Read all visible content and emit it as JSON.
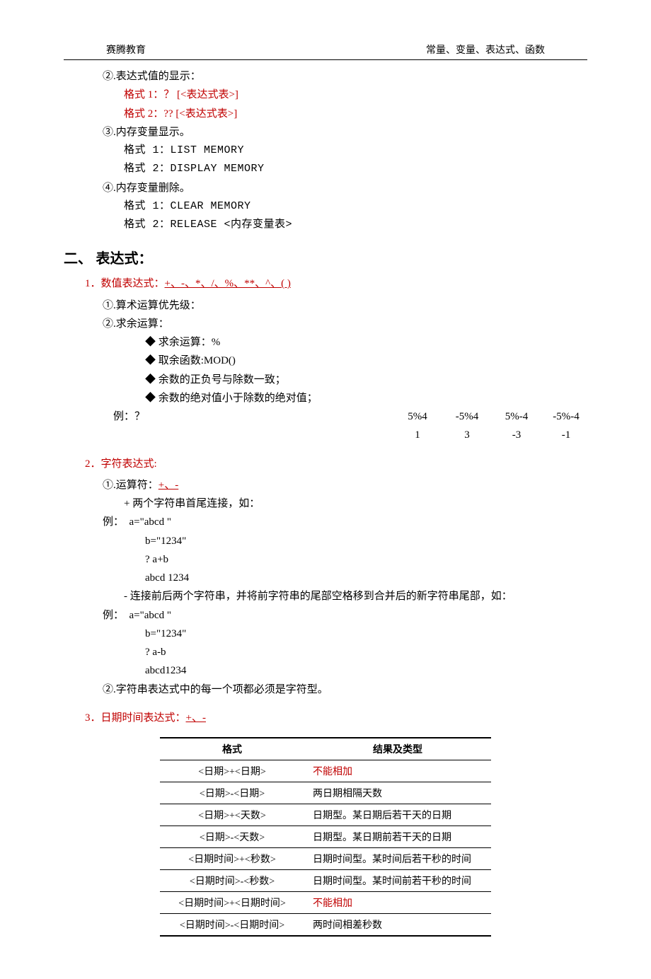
{
  "header": {
    "left": "赛腾教育",
    "right": "常量、变量、表达式、函数"
  },
  "s1": {
    "p2": {
      "title": "②.表达式值的显示：",
      "l1": "格式 1：？ [<表达式表>]",
      "l2": "格式 2：?? [<表达式表>]"
    },
    "p3": {
      "title": "③.内存变量显示。",
      "l1": "格式 1：LIST MEMORY",
      "l2": "格式 2：DISPLAY MEMORY"
    },
    "p4": {
      "title": "④.内存变量删除。",
      "l1": "格式 1：CLEAR MEMORY",
      "l2": "格式 2：RELEASE <内存变量表>"
    }
  },
  "h2": "二、 表达式：",
  "num": {
    "title_a": "1．数值表达式：",
    "title_b": "+、-、*、/、%、**、^、( )",
    "p1": "①.算术运算优先级：",
    "p2": "②.求余运算：",
    "b1": "求余运算：%",
    "b2": "取余函数:MOD()",
    "b3": "余数的正负号与除数一致；",
    "b4": "余数的绝对值小于除数的绝对值；",
    "ex_lbl": "例：？",
    "ex_c1": "5%4",
    "ex_c2": "-5%4",
    "ex_c3": "5%-4",
    "ex_c4": "-5%-4",
    "ex_v1": "1",
    "ex_v2": "3",
    "ex_v3": "-3",
    "ex_v4": "-1"
  },
  "str": {
    "title": "2．字符表达式:",
    "p1a": "①.运算符：",
    "p1b": "+、-",
    "plus": "+ 两个字符串首尾连接，如：",
    "ex1_lbl": "例：",
    "ex1_l1": "a=\"abcd \"",
    "ex1_l2": "b=\"1234\"",
    "ex1_l3": "? a+b",
    "ex1_l4": "abcd 1234",
    "minus": "-   连接前后两个字符串，并将前字符串的尾部空格移到合并后的新字符串尾部，如：",
    "ex2_lbl": "例：",
    "ex2_l1": "a=\"abcd \"",
    "ex2_l2": "b=\"1234\"",
    "ex2_l3": "? a-b",
    "ex2_l4": "abcd1234",
    "p2": "②.字符串表达式中的每一个项都必须是字符型。"
  },
  "dt": {
    "title_a": "3．日期时间表达式：",
    "title_b": "+、-",
    "th1": "格式",
    "th2": "结果及类型",
    "rows": [
      {
        "f": "<日期>+<日期>",
        "r": "不能相加",
        "red": true
      },
      {
        "f": "<日期>-<日期>",
        "r": "两日期相隔天数",
        "red": false
      },
      {
        "f": "<日期>+<天数>",
        "r": "日期型。某日期后若干天的日期",
        "red": false
      },
      {
        "f": "<日期>-<天数>",
        "r": "日期型。某日期前若干天的日期",
        "red": false
      },
      {
        "f": "<日期时间>+<秒数>",
        "r": "日期时间型。某时间后若干秒的时间",
        "red": false
      },
      {
        "f": "<日期时间>-<秒数>",
        "r": "日期时间型。某时间前若干秒的时间",
        "red": false
      },
      {
        "f": "<日期时间>+<日期时间>",
        "r": "不能相加",
        "red": true
      },
      {
        "f": "<日期时间>-<日期时间>",
        "r": "两时间相差秒数",
        "red": false
      }
    ]
  }
}
